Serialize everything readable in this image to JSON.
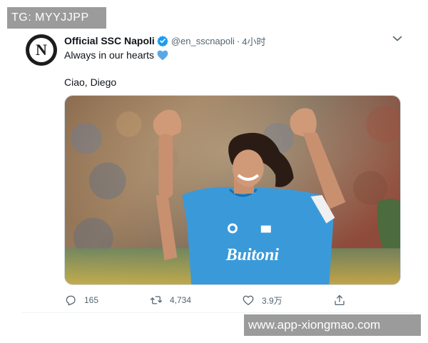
{
  "watermarks": {
    "top": "TG: MYYJJPP",
    "bottom": "www.app-xiongmao.com"
  },
  "tweet": {
    "avatar_letter": "N",
    "display_name": "Official SSC Napoli",
    "verified": true,
    "handle": "@en_sscnapoli",
    "separator": "·",
    "time": "4小时",
    "text_line1": "Always in our hearts",
    "heart_emoji_color": "#5aa7e8",
    "text_line2": "Ciao, Diego",
    "media_jersey_text": "Buitoni",
    "counts": {
      "replies": "165",
      "retweets": "4,734",
      "likes": "3.9万"
    }
  },
  "icons": {
    "avatar": "ssc-napoli-logo",
    "verified": "verified-badge-icon",
    "caret": "chevron-down-icon",
    "emoji": "blue-heart-icon",
    "reply": "reply-icon",
    "retweet": "retweet-icon",
    "like": "like-icon",
    "share": "share-icon"
  },
  "colors": {
    "text_primary": "#0f1419",
    "text_secondary": "#536471",
    "verified_blue": "#1d9bf0",
    "watermark_bg": "#9b9b9b"
  }
}
